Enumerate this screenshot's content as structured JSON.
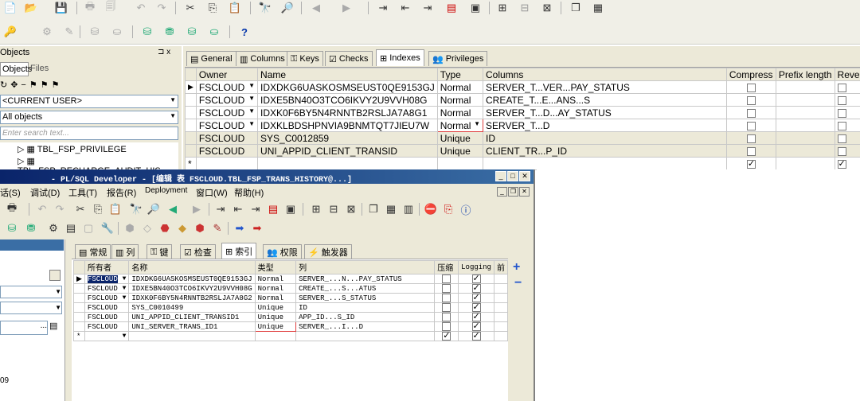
{
  "back_window": {
    "left_panel": {
      "title": "Objects",
      "pin": "⊐ x",
      "tabs": [
        "Objects",
        "Files"
      ],
      "user_filter": "<CURRENT USER>",
      "object_filter": "All objects",
      "search_placeholder": "Enter search text...",
      "tree_items": [
        "TBL_FSP_PRIVILEGE",
        "TBL_FSP_RECHARGE_AUDIT_HIS"
      ]
    },
    "tabs": [
      "General",
      "Columns",
      "Keys",
      "Checks",
      "Indexes",
      "Privileges"
    ],
    "active_tab": "Indexes",
    "grid": {
      "headers": [
        "Owner",
        "Name",
        "Type",
        "Columns",
        "Compress",
        "Prefix length",
        "Reve"
      ],
      "rows": [
        {
          "owner": "FSCLOUD",
          "name": "IDXDKG6UASKOSMSEUST0QE9153GJ",
          "type": "Normal",
          "columns": "SERVER_T...VER...PAY_STATUS",
          "compress": false,
          "marker": "▶"
        },
        {
          "owner": "FSCLOUD",
          "name": "IDXE5BN40O3TCO6IKVY2U9VVH08G",
          "type": "Normal",
          "columns": "CREATE_T...E...ANS...S",
          "compress": false,
          "marker": ""
        },
        {
          "owner": "FSCLOUD",
          "name": "IDXK0F6BY5N4RNNTB2RSLJA7A8G1",
          "type": "Normal",
          "columns": "SERVER_T...D...AY_STATUS",
          "compress": false,
          "marker": ""
        },
        {
          "owner": "FSCLOUD",
          "name": "IDXKLBDSHPNVIA9BNMTQT7JIEU7W",
          "type": "Normal",
          "columns": "SERVER_T...D",
          "compress": false,
          "marker": ""
        },
        {
          "owner": "FSCLOUD",
          "name": "SYS_C0012859",
          "type": "Unique",
          "columns": "ID",
          "compress": false,
          "marker": ""
        },
        {
          "owner": "FSCLOUD",
          "name": "UNI_APPID_CLIENT_TRANSID",
          "type": "Unique",
          "columns": "CLIENT_TR...P_ID",
          "compress": false,
          "marker": ""
        }
      ],
      "new_row_marker": "*"
    }
  },
  "front_window": {
    "title": "- PL/SQL Developer - [编辑 表 FSCLOUD.TBL_FSP_TRANS_HISTORY@...]",
    "menu": [
      "话(S)",
      "调试(D)",
      "工具(T)",
      "报告(R)",
      "Deployment",
      "窗口(W)",
      "帮助(H)"
    ],
    "tabs": [
      "常规",
      "列",
      "键",
      "检查",
      "索引",
      "权限",
      "触发器"
    ],
    "active_tab": "索引",
    "left_value": "09",
    "grid": {
      "headers": [
        "所有者",
        "名称",
        "类型",
        "列",
        "压缩",
        "Logging",
        "前"
      ],
      "rows": [
        {
          "owner": "FSCLOUD",
          "name": "IDXDKG6UASKOSMSEUST0QE9153GJ",
          "type": "Normal",
          "columns": "SERVER_...N...PAY_STATUS",
          "compress": false,
          "logging": true,
          "marker": "▶"
        },
        {
          "owner": "FSCLOUD",
          "name": "IDXE5BN40O3TCO6IKVY2U9VVH08G",
          "type": "Normal",
          "columns": "CREATE_...S...ATUS",
          "compress": false,
          "logging": true,
          "marker": ""
        },
        {
          "owner": "FSCLOUD",
          "name": "IDXK0F6BY5N4RNNTB2RSLJA7A8G2",
          "type": "Normal",
          "columns": "SERVER_...S_STATUS",
          "compress": false,
          "logging": true,
          "marker": ""
        },
        {
          "owner": "FSCLOUD",
          "name": "SYS_C0010499",
          "type": "Unique",
          "columns": "ID",
          "compress": false,
          "logging": true,
          "marker": ""
        },
        {
          "owner": "FSCLOUD",
          "name": "UNI_APPID_CLIENT_TRANSID1",
          "type": "Unique",
          "columns": "APP_ID...S_ID",
          "compress": false,
          "logging": true,
          "marker": ""
        },
        {
          "owner": "FSCLOUD",
          "name": "UNI_SERVER_TRANS_ID1",
          "type": "Unique",
          "columns": "SERVER_...I...D",
          "compress": false,
          "logging": true,
          "marker": ""
        }
      ],
      "new_row_marker": "*"
    },
    "side_buttons": [
      "+",
      "−"
    ]
  },
  "colors": {
    "highlight_border": "#e04040",
    "title_bar": "#0a246a",
    "accent": "#3a6ea5"
  }
}
